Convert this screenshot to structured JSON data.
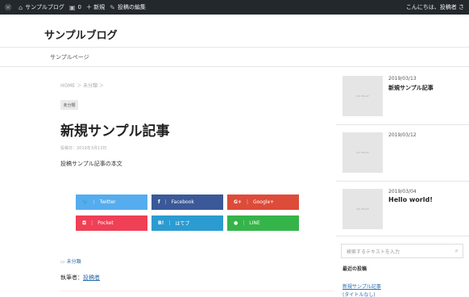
{
  "admin_bar": {
    "site_name": "サンプルブログ",
    "comments_count": "0",
    "new_label": "＋ 新規",
    "edit_label": "投稿の編集",
    "greeting": "こんにちは、投稿者 さ"
  },
  "site": {
    "title": "サンプルブログ",
    "nav_item": "サンプルページ"
  },
  "post": {
    "breadcrumb": "HOME ＞ 未分類 ＞",
    "category_tag": "未分類",
    "title": "新規サンプル記事",
    "date": "投稿日：2019年3月13日",
    "body": "投稿サンプル記事の本文",
    "category_link": "未分類",
    "author_label": "執筆者：",
    "author_name": "投稿者"
  },
  "share_buttons": [
    {
      "label": "Twitter",
      "icon": "twitter-icon",
      "glyph": "🐦",
      "color": "#55acee"
    },
    {
      "label": "Facebook",
      "icon": "facebook-icon",
      "glyph": "f",
      "color": "#3b5998"
    },
    {
      "label": "Google+",
      "icon": "googleplus-icon",
      "glyph": "G+",
      "color": "#dd4b39"
    },
    {
      "label": "Pocket",
      "icon": "pocket-icon",
      "glyph": "◘",
      "color": "#ef4056"
    },
    {
      "label": "はてブ",
      "icon": "hatena-icon",
      "glyph": "B!",
      "color": "#2c9bd1"
    },
    {
      "label": "LINE",
      "icon": "line-icon",
      "glyph": "●",
      "color": "#35b44a"
    }
  ],
  "sidebar": {
    "posts": [
      {
        "date": "2019/03/13",
        "title": "新規サンプル記事",
        "thumb": "NO IMAGE"
      },
      {
        "date": "2019/03/12",
        "title": "",
        "thumb": "NO IMAGE"
      },
      {
        "date": "2019/03/04",
        "title": "Hello world!",
        "thumb": "NO IMAGE"
      }
    ],
    "search_placeholder": "検索するテキストを入力",
    "recent_heading": "最近の投稿",
    "recent_links": [
      "新規サンプル記事",
      "(タイトルなし)"
    ]
  }
}
